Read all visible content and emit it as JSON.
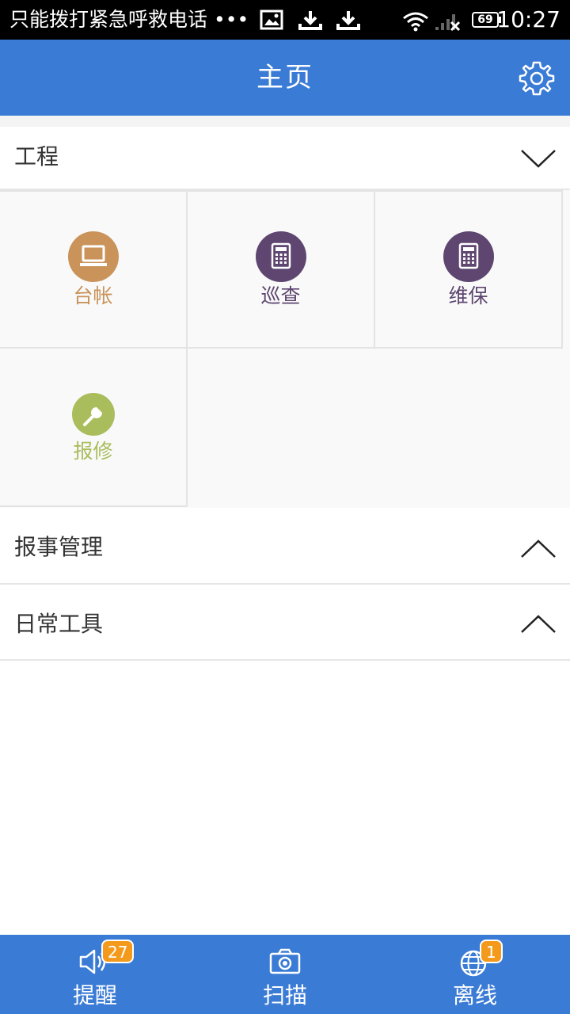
{
  "status_bar": {
    "notification_text": "只能拨打紧急呼救电话 •••",
    "battery": "69",
    "time": "10:27"
  },
  "header": {
    "title": "主页"
  },
  "sections": {
    "engineering": {
      "label": "工程",
      "state": "expanded",
      "items": [
        {
          "label": "台帐",
          "icon": "laptop-icon",
          "color": "#c9935a"
        },
        {
          "label": "巡查",
          "icon": "calculator-icon",
          "color": "#5e4670"
        },
        {
          "label": "维保",
          "icon": "calculator-icon",
          "color": "#5e4670"
        },
        {
          "label": "报修",
          "icon": "wrench-icon",
          "color": "#a9bd5c"
        }
      ]
    },
    "report_management": {
      "label": "报事管理",
      "state": "collapsed"
    },
    "daily_tools": {
      "label": "日常工具",
      "state": "collapsed"
    }
  },
  "bottom_nav": [
    {
      "label": "提醒",
      "icon": "speaker-icon",
      "badge": "27"
    },
    {
      "label": "扫描",
      "icon": "camera-icon"
    },
    {
      "label": "离线",
      "icon": "globe-icon",
      "badge": "1"
    }
  ],
  "colors": {
    "primary": "#3a7bd5",
    "badge": "#f39a1d"
  }
}
